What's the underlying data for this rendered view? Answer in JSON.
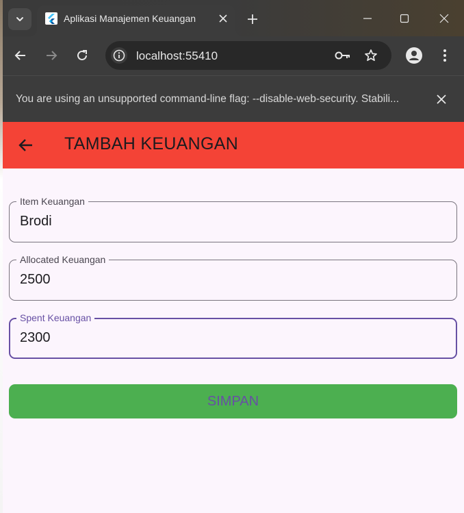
{
  "browser": {
    "tab_title": "Aplikasi Manajemen Keuangan",
    "url": "localhost:55410",
    "infobar_text": "You are using an unsupported command-line flag: --disable-web-security. Stabili..."
  },
  "appbar": {
    "title": "TAMBAH KEUANGAN"
  },
  "form": {
    "fields": [
      {
        "label": "Item Keuangan",
        "value": "Brodi"
      },
      {
        "label": "Allocated Keuangan",
        "value": "2500"
      },
      {
        "label": "Spent Keuangan",
        "value": "2300"
      }
    ],
    "submit_label": "SIMPAN"
  },
  "colors": {
    "appbar": "#f44336",
    "submit_button": "#4caf50",
    "accent": "#6750a4",
    "page_background": "#fcf5fd"
  },
  "icons": {
    "tab_search": "chevron-down-icon",
    "favicon": "flutter-icon",
    "back": "arrow-left-icon",
    "forward": "arrow-right-icon",
    "reload": "reload-icon",
    "site_info": "info-icon",
    "password": "key-icon",
    "bookmark": "star-icon",
    "profile": "person-icon",
    "menu": "more-vert-icon"
  }
}
